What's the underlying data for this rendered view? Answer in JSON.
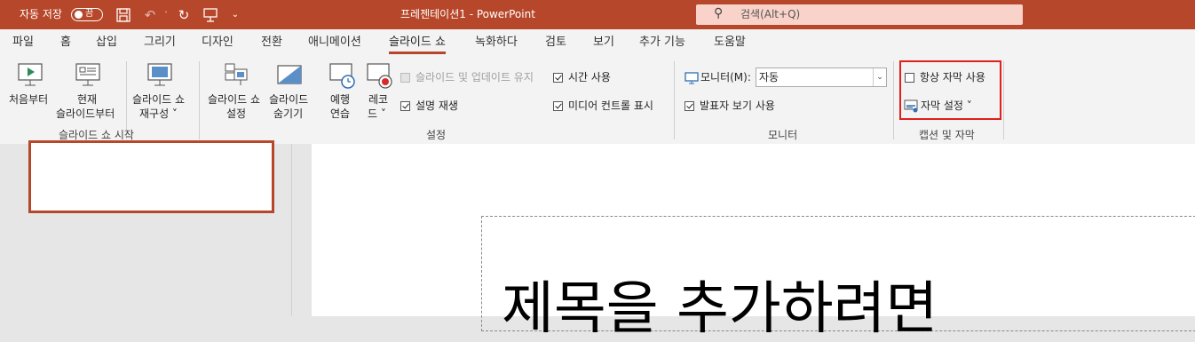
{
  "titlebar": {
    "autosave_label": "자동 저장",
    "autosave_state": "끔",
    "doc_title": "프레젠테이션1  -  PowerPoint",
    "search_placeholder": "검색(Alt+Q)",
    "accent_color": "#b7472a"
  },
  "menu": {
    "tabs": [
      "파일",
      "홈",
      "삽입",
      "그리기",
      "디자인",
      "전환",
      "애니메이션",
      "슬라이드 쇼",
      "녹화하다",
      "검토",
      "보기",
      "추가 기능",
      "도움말"
    ],
    "active_tab": "슬라이드 쇼"
  },
  "ribbon": {
    "start_group": {
      "from_beginning": "처음부터",
      "from_current_1": "현재",
      "from_current_2": "슬라이드부터",
      "custom_1": "슬라이드 쇼",
      "custom_2": "재구성 ˅",
      "label": "슬라이드 쇼 시작"
    },
    "setup_group": {
      "setup_1": "슬라이드 쇼",
      "setup_2": "설정",
      "hide_1": "슬라이드",
      "hide_2": "숨기기",
      "rehearse_1": "예행",
      "rehearse_2": "연습",
      "record_1": "레코",
      "record_2": "드 ˅",
      "keep_updated": "슬라이드 및 업데이트 유지",
      "play_narration": "설명 재생",
      "use_timings": "시간 사용",
      "show_media_controls": "미디어 컨트롤 표시",
      "label": "설정"
    },
    "monitor_group": {
      "monitor_label": "모니터(M):",
      "monitor_value": "자동",
      "presenter_view": "발표자 보기 사용",
      "label": "모니터"
    },
    "captions_group": {
      "always_subtitles": "항상 자막 사용",
      "subtitle_settings": "자막 설정 ˅",
      "label": "캡션 및 자막"
    }
  },
  "slide": {
    "title_text": "제목을 추가하려면"
  }
}
